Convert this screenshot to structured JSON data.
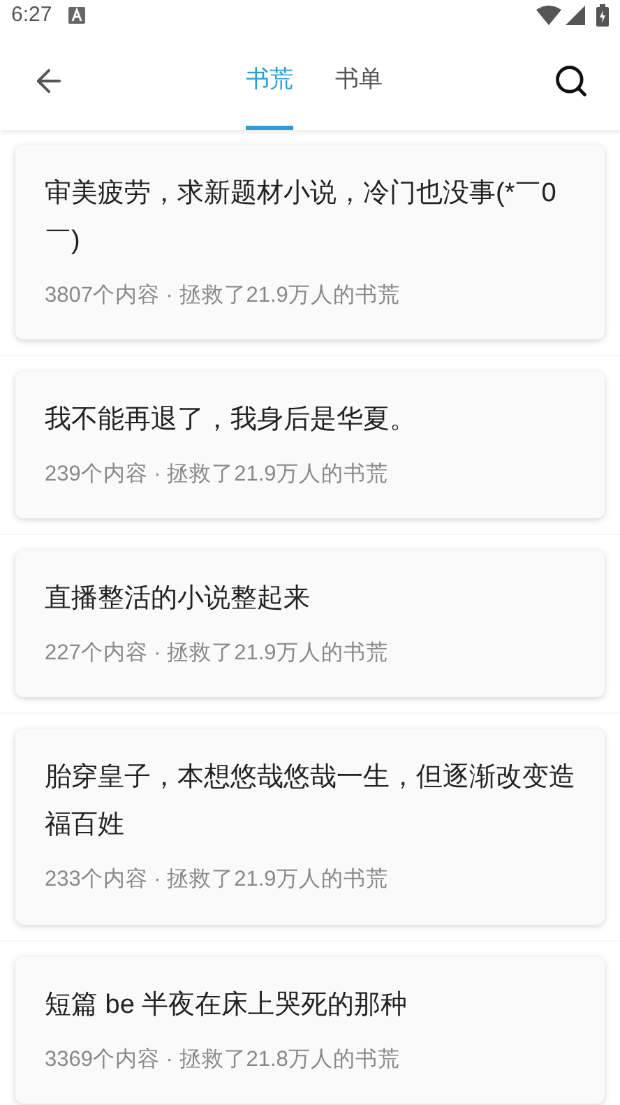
{
  "status_bar": {
    "time": "6:27"
  },
  "header": {
    "tabs": [
      {
        "label": "书荒",
        "selected": true
      },
      {
        "label": "书单",
        "selected": false
      }
    ]
  },
  "posts": [
    {
      "title": "审美疲劳，求新题材小说，冷门也没事(*￣0￣)",
      "meta": "3807个内容 · 拯救了21.9万人的书荒"
    },
    {
      "title": "我不能再退了，我身后是华夏。",
      "meta": "239个内容 · 拯救了21.9万人的书荒"
    },
    {
      "title": "直播整活的小说整起来",
      "meta": "227个内容 · 拯救了21.9万人的书荒"
    },
    {
      "title": "胎穿皇子，本想悠哉悠哉一生，但逐渐改变造福百姓",
      "meta": "233个内容 · 拯救了21.9万人的书荒"
    },
    {
      "title": "短篇 be 半夜在床上哭死的那种",
      "meta": "3369个内容 · 拯救了21.8万人的书荒"
    }
  ]
}
